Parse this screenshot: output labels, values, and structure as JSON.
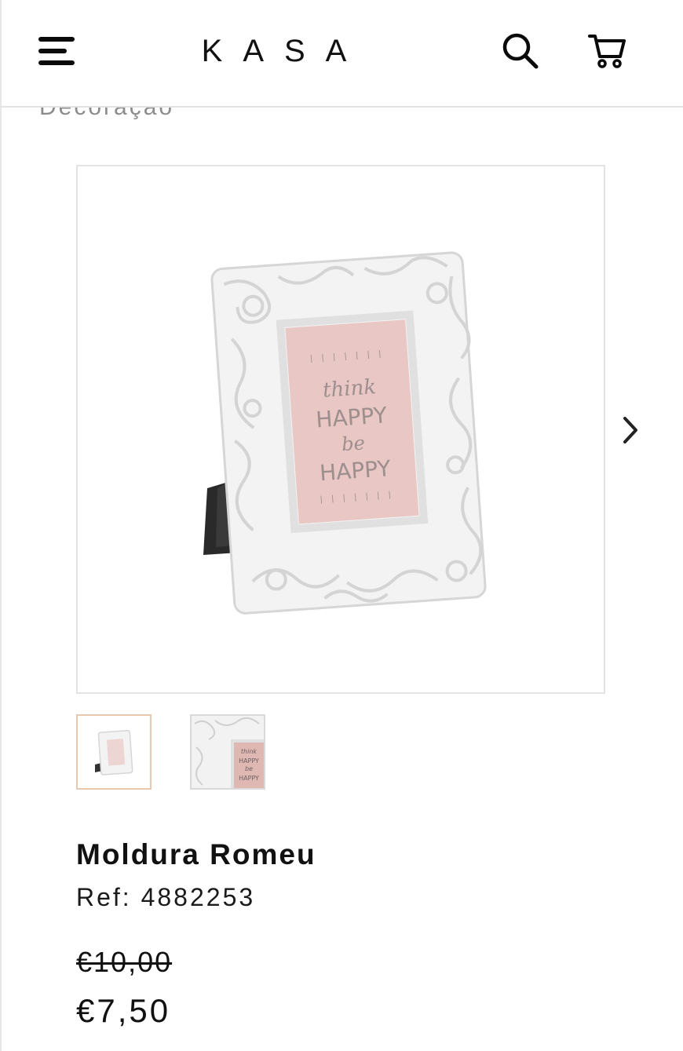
{
  "header": {
    "logo_text": "KASA",
    "menu_icon": "hamburger-menu-icon",
    "search_icon": "search-icon",
    "cart_icon": "cart-icon"
  },
  "breadcrumb": {
    "category": "Decoração"
  },
  "gallery": {
    "artwork_text": {
      "line1": "think",
      "line2": "HAPPY",
      "line3": "be",
      "line4": "HAPPY"
    },
    "next_icon": "chevron-right-icon",
    "thumbnail_count": 2,
    "selected_thumbnail": 1
  },
  "product": {
    "name": "Moldura Romeu",
    "ref": "Ref: 4882253",
    "old_price": "€10,00",
    "price": "€7,50"
  },
  "colors": {
    "selected_thumb_border": "#e8c9b0",
    "artwork_pink": "#e9c7c4",
    "frame_white": "#f4f4f4",
    "text_dark": "#111111",
    "breadcrumb_grey": "#8c8c8c"
  }
}
